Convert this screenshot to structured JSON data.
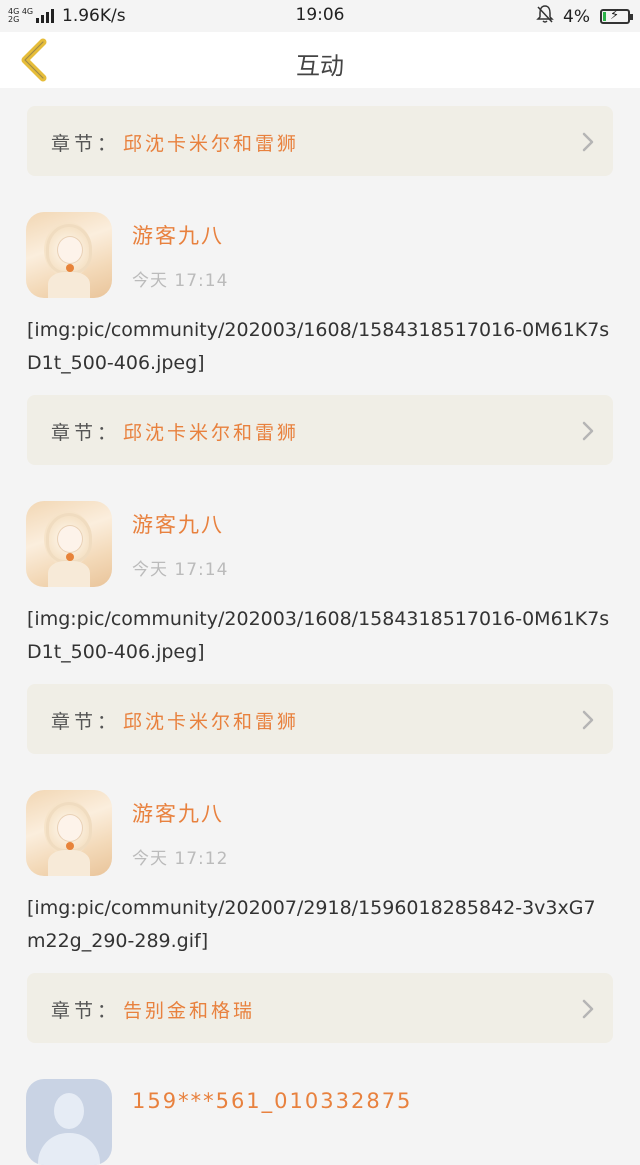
{
  "status_bar": {
    "network": "4G 4G 2G",
    "speed": "1.96K/s",
    "time": "19:06",
    "battery_percent": "4%",
    "battery_level": 0.04
  },
  "header": {
    "title": "互动"
  },
  "feed": [
    {
      "chapter": {
        "prefix": "章节：",
        "name": "邱沈卡米尔和雷狮"
      }
    },
    {
      "user": {
        "name": "游客九八",
        "time": "今天 17:14"
      },
      "text": "[img:pic/community/202003/1608/1584318517016-0M61K7sD1t_500-406.jpeg]",
      "chapter": {
        "prefix": "章节：",
        "name": "邱沈卡米尔和雷狮"
      }
    },
    {
      "user": {
        "name": "游客九八",
        "time": "今天 17:14"
      },
      "text": "[img:pic/community/202003/1608/1584318517016-0M61K7sD1t_500-406.jpeg]",
      "chapter": {
        "prefix": "章节：",
        "name": "邱沈卡米尔和雷狮"
      }
    },
    {
      "user": {
        "name": "游客九八",
        "time": "今天 17:12"
      },
      "text": "[img:pic/community/202007/2918/1596018285842-3v3xG7m22g_290-289.gif]",
      "chapter": {
        "prefix": "章节：",
        "name": "告别金和格瑞"
      }
    },
    {
      "user": {
        "name": "159***561_010332875"
      }
    }
  ],
  "colors": {
    "accent": "#e8813e",
    "chapter_bg": "#f0eee6",
    "page_bg": "#f4f4f4",
    "back_arrow": "#e6bd3a"
  }
}
